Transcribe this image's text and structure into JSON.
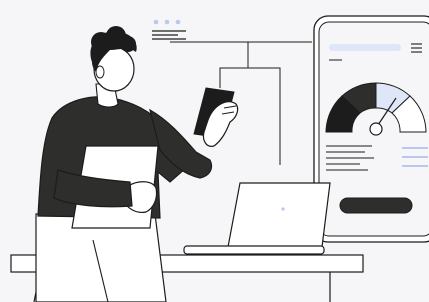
{
  "colors": {
    "background": "#f6f6f8",
    "outline": "#1c1c1c",
    "dark_fill": "#2e2e2c",
    "accent_light": "#dfe6f8",
    "accent_mid": "#b9c8ef",
    "white": "#ffffff"
  },
  "icons": {
    "menu": "hamburger-icon",
    "gauge": "speedometer-gauge",
    "dots": "three-dots-icon"
  },
  "gauge": {
    "level": 0.72
  }
}
